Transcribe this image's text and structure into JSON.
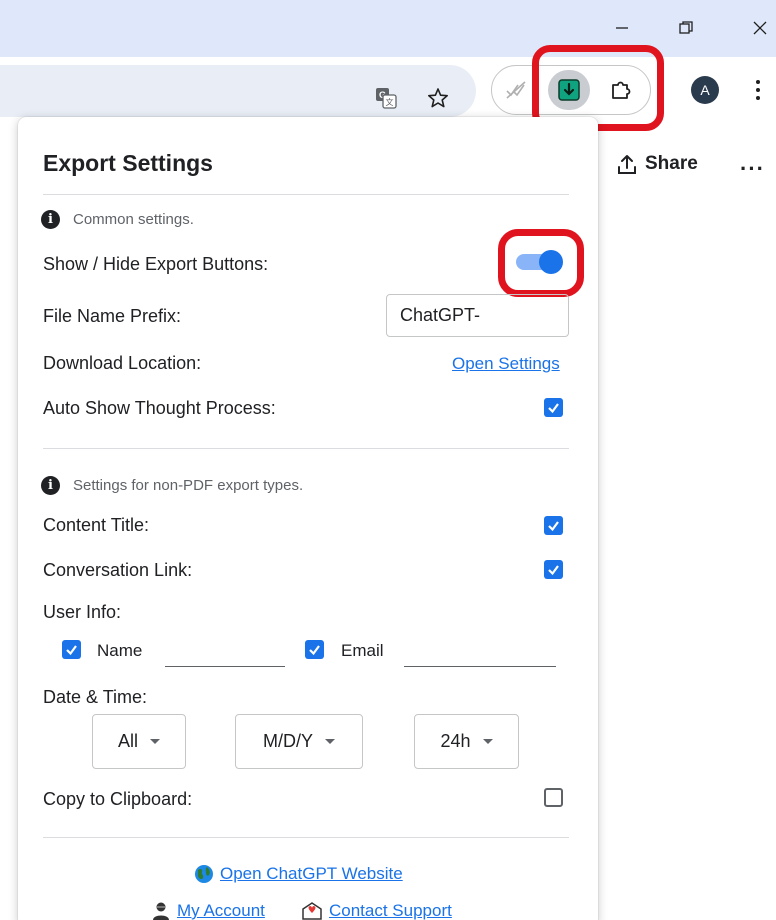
{
  "browser": {
    "window_controls": {
      "minimize": "—",
      "restore": "❐",
      "close": "✕"
    },
    "avatar_letter": "A"
  },
  "page": {
    "share_label": "Share",
    "more_label": "···"
  },
  "popup": {
    "title": "Export Settings",
    "common_section": {
      "info": "Common settings.",
      "show_hide_label": "Show / Hide Export Buttons:",
      "show_hide_enabled": true,
      "file_prefix_label": "File Name Prefix:",
      "file_prefix_value": "ChatGPT-",
      "download_location_label": "Download Location:",
      "open_settings_link": "Open Settings",
      "auto_show_label": "Auto Show Thought Process:",
      "auto_show_checked": true
    },
    "non_pdf_section": {
      "info": "Settings for non-PDF export types.",
      "content_title_label": "Content Title:",
      "content_title_checked": true,
      "conversation_link_label": "Conversation Link:",
      "conversation_link_checked": true,
      "user_info_label": "User Info:",
      "name_label": "Name",
      "name_checked": true,
      "name_value": "",
      "email_label": "Email",
      "email_checked": true,
      "email_value": "",
      "date_time_label": "Date & Time:",
      "date_range_value": "All",
      "date_format_value": "M/D/Y",
      "time_format_value": "24h",
      "copy_clipboard_label": "Copy to Clipboard:",
      "copy_clipboard_checked": false
    },
    "footer": {
      "website_link": "Open ChatGPT Website",
      "account_link": "My Account",
      "support_link": "Contact Support"
    }
  },
  "colors": {
    "accent": "#1a73e8",
    "highlight": "#e0141e",
    "titlebar": "#dfe8fb",
    "extension_green": "#10a37f"
  }
}
